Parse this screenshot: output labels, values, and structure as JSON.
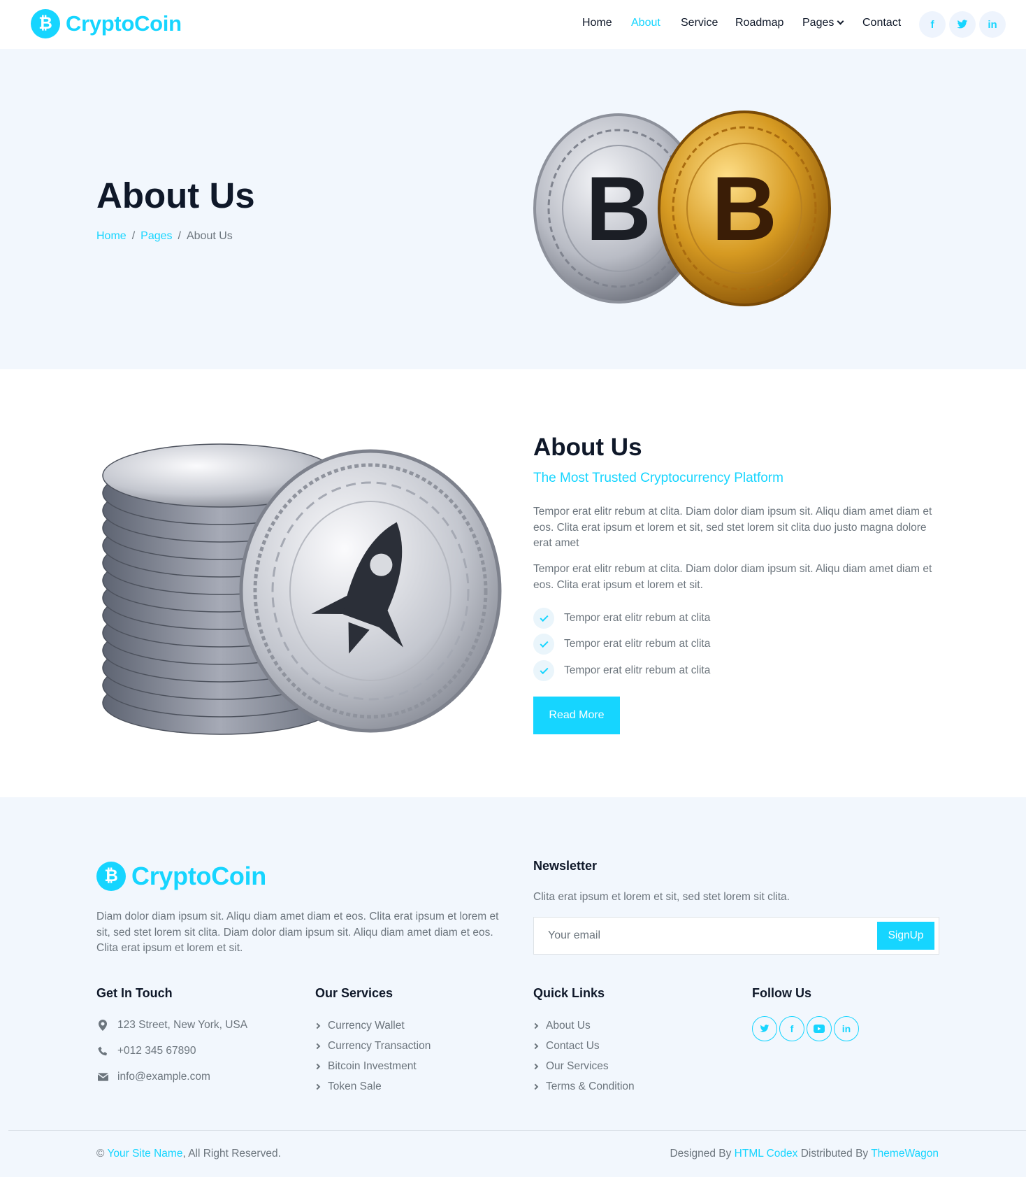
{
  "brand": {
    "name": "CryptoCoin",
    "icon": "bitcoin-icon"
  },
  "nav": {
    "items": [
      "Home",
      "About",
      "Service",
      "Roadmap",
      "Pages",
      "Contact"
    ],
    "active": "About",
    "social_icons": [
      "facebook-icon",
      "twitter-icon",
      "linkedin-icon"
    ]
  },
  "hero": {
    "title": "About Us",
    "breadcrumb": [
      "Home",
      "Pages",
      "About Us"
    ],
    "image": "bitcoin-coins-image"
  },
  "about": {
    "title": "About Us",
    "subtitle": "The Most Trusted Cryptocurrency Platform",
    "paragraph_1": "Tempor erat elitr rebum at clita. Diam dolor diam ipsum sit. Aliqu diam amet diam et eos. Clita erat ipsum et lorem et sit, sed stet lorem sit clita duo justo magna dolore erat amet",
    "paragraph_2": "Tempor erat elitr rebum at clita. Diam dolor diam ipsum sit. Aliqu diam amet diam et eos. Clita erat ipsum et lorem et sit.",
    "checklist": [
      "Tempor erat elitr rebum at clita",
      "Tempor erat elitr rebum at clita",
      "Tempor erat elitr rebum at clita"
    ],
    "button": "Read More",
    "image": "rocket-coin-stack-image"
  },
  "footer": {
    "brand": "CryptoCoin",
    "about": "Diam dolor diam ipsum sit. Aliqu diam amet diam et eos. Clita erat ipsum et lorem et sit, sed stet lorem sit clita. Diam dolor diam ipsum sit. Aliqu diam amet diam et eos. Clita erat ipsum et lorem et sit.",
    "newsletter": {
      "title": "Newsletter",
      "text": "Clita erat ipsum et lorem et sit, sed stet lorem sit clita.",
      "placeholder": "Your email",
      "button": "SignUp"
    },
    "get_in_touch": {
      "title": "Get In Touch",
      "address": "123 Street, New York, USA",
      "phone": "+012 345 67890",
      "email": "info@example.com"
    },
    "services": {
      "title": "Our Services",
      "items": [
        "Currency Wallet",
        "Currency Transaction",
        "Bitcoin Investment",
        "Token Sale"
      ]
    },
    "quick_links": {
      "title": "Quick Links",
      "items": [
        "About Us",
        "Contact Us",
        "Our Services",
        "Terms & Condition"
      ]
    },
    "follow": {
      "title": "Follow Us",
      "icons": [
        "twitter-icon",
        "facebook-icon",
        "youtube-icon",
        "linkedin-icon"
      ]
    },
    "copyright": {
      "symbol": "©",
      "site": "Your Site Name",
      "rights": ", All Right Reserved.",
      "designed_by": "Designed By",
      "codex": "HTML Codex",
      "distributed_by": "Distributed By",
      "wagon": "ThemeWagon"
    }
  },
  "colors": {
    "accent": "#16d5ff",
    "heading": "#0f1829",
    "text": "#6c757d",
    "light_bg": "#f2f7fd"
  }
}
